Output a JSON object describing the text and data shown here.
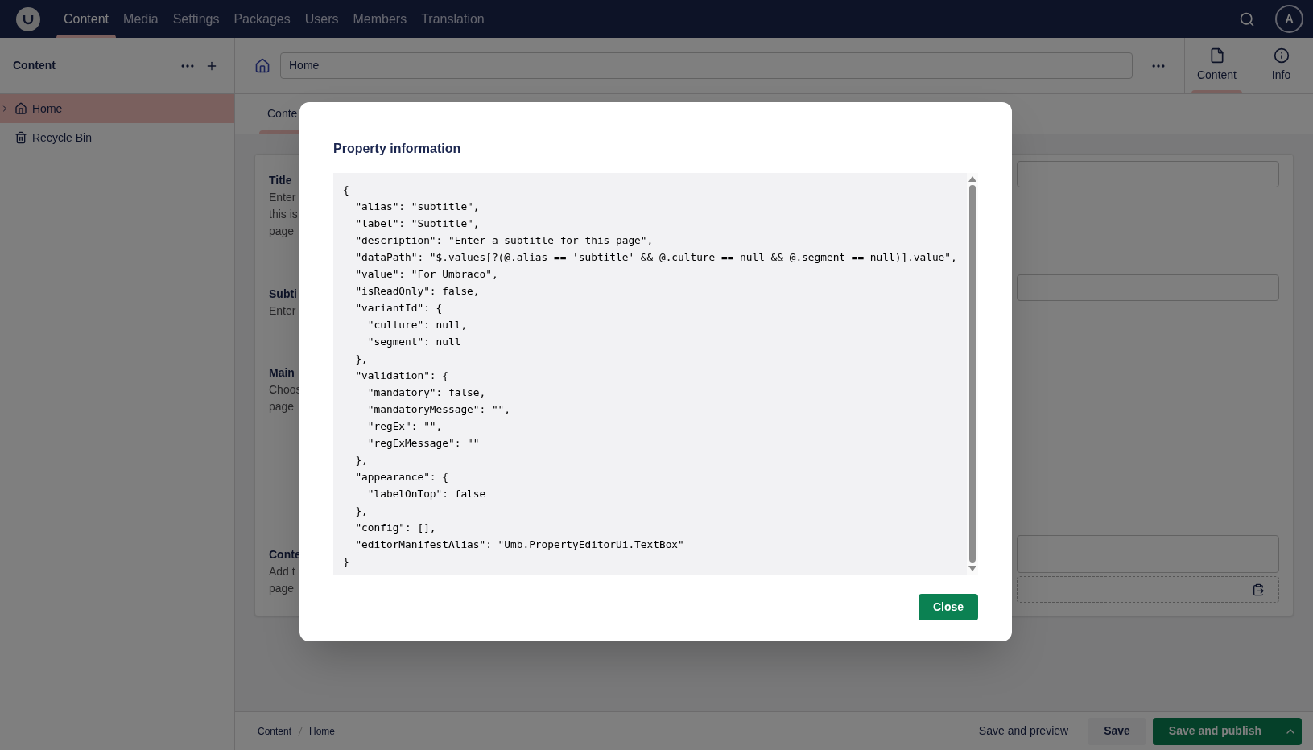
{
  "nav": [
    {
      "label": "Content",
      "selected": true
    },
    {
      "label": "Media",
      "selected": false
    },
    {
      "label": "Settings",
      "selected": false
    },
    {
      "label": "Packages",
      "selected": false
    },
    {
      "label": "Users",
      "selected": false
    },
    {
      "label": "Members",
      "selected": false
    },
    {
      "label": "Translation",
      "selected": false
    }
  ],
  "user": {
    "initial": "A"
  },
  "sidebar": {
    "title": "Content",
    "items": [
      {
        "label": "Home",
        "kind": "home",
        "selected": true,
        "expandable": true
      },
      {
        "label": "Recycle Bin",
        "kind": "trash",
        "selected": false,
        "expandable": false
      }
    ]
  },
  "document": {
    "name": "Home",
    "views": [
      {
        "label": "Content",
        "kind": "document",
        "selected": true
      },
      {
        "label": "Info",
        "kind": "info",
        "selected": false
      }
    ],
    "tabs": [
      {
        "label": "Conte",
        "selected": true
      }
    ]
  },
  "properties": [
    {
      "label": "Title",
      "description": "Enter\nthis is\npage",
      "kind": "text"
    },
    {
      "label": "Subti",
      "description": "Enter",
      "kind": "text"
    },
    {
      "label": "Main",
      "description": "Choos\npage",
      "kind": "media"
    },
    {
      "label": "Conte",
      "description": "Add t\npage",
      "kind": "blocks"
    }
  ],
  "footer": {
    "breadcrumbs": [
      {
        "label": "Content",
        "link": true
      },
      {
        "label": "Home",
        "link": false
      }
    ],
    "buttons": [
      {
        "label": "Save and preview",
        "kind": "plain"
      },
      {
        "label": "Save",
        "kind": "secondary"
      },
      {
        "label": "Save and publish",
        "kind": "primary"
      }
    ]
  },
  "dialog": {
    "title": "Property information",
    "code": [
      "{",
      "  \"alias\": \"subtitle\",",
      "  \"label\": \"Subtitle\",",
      "  \"description\": \"Enter a subtitle for this page\",",
      "  \"dataPath\": \"$.values[?(@.alias == 'subtitle' && @.culture == null && @.segment == null)].value\",",
      "  \"value\": \"For Umbraco\",",
      "  \"isReadOnly\": false,",
      "  \"variantId\": {",
      "    \"culture\": null,",
      "    \"segment\": null",
      "  },",
      "  \"validation\": {",
      "    \"mandatory\": false,",
      "    \"mandatoryMessage\": \"\",",
      "    \"regEx\": \"\",",
      "    \"regExMessage\": \"\"",
      "  },",
      "  \"appearance\": {",
      "    \"labelOnTop\": false",
      "  },",
      "  \"config\": [],",
      "  \"editorManifestAlias\": \"Umb.PropertyEditorUi.TextBox\"",
      "}"
    ],
    "button": "Close"
  }
}
